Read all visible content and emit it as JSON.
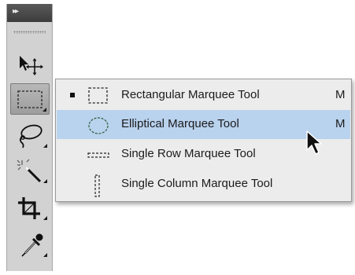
{
  "toolbar": {
    "collapse_glyph": "▸▸",
    "tools": [
      {
        "name": "move-tool",
        "icon": "move-icon"
      },
      {
        "name": "marquee-tool",
        "icon": "rectangular-marquee-icon",
        "active": true
      },
      {
        "name": "lasso-tool",
        "icon": "lasso-icon"
      },
      {
        "name": "magic-wand-tool",
        "icon": "magic-wand-icon"
      },
      {
        "name": "crop-tool",
        "icon": "crop-icon"
      },
      {
        "name": "eyedropper-tool",
        "icon": "eyedropper-icon"
      }
    ]
  },
  "flyout": {
    "items": [
      {
        "label": "Rectangular Marquee Tool",
        "shortcut": "M",
        "selected": true,
        "icon": "rectangular-marquee-icon"
      },
      {
        "label": "Elliptical Marquee Tool",
        "shortcut": "M",
        "highlighted": true,
        "icon": "elliptical-marquee-icon"
      },
      {
        "label": "Single Row Marquee Tool",
        "shortcut": "",
        "icon": "single-row-marquee-icon"
      },
      {
        "label": "Single Column Marquee Tool",
        "shortcut": "",
        "icon": "single-column-marquee-icon"
      }
    ]
  },
  "colors": {
    "highlight": "#b9d2ee",
    "panel": "#d2d2d2",
    "menu_bg": "#ececec"
  }
}
